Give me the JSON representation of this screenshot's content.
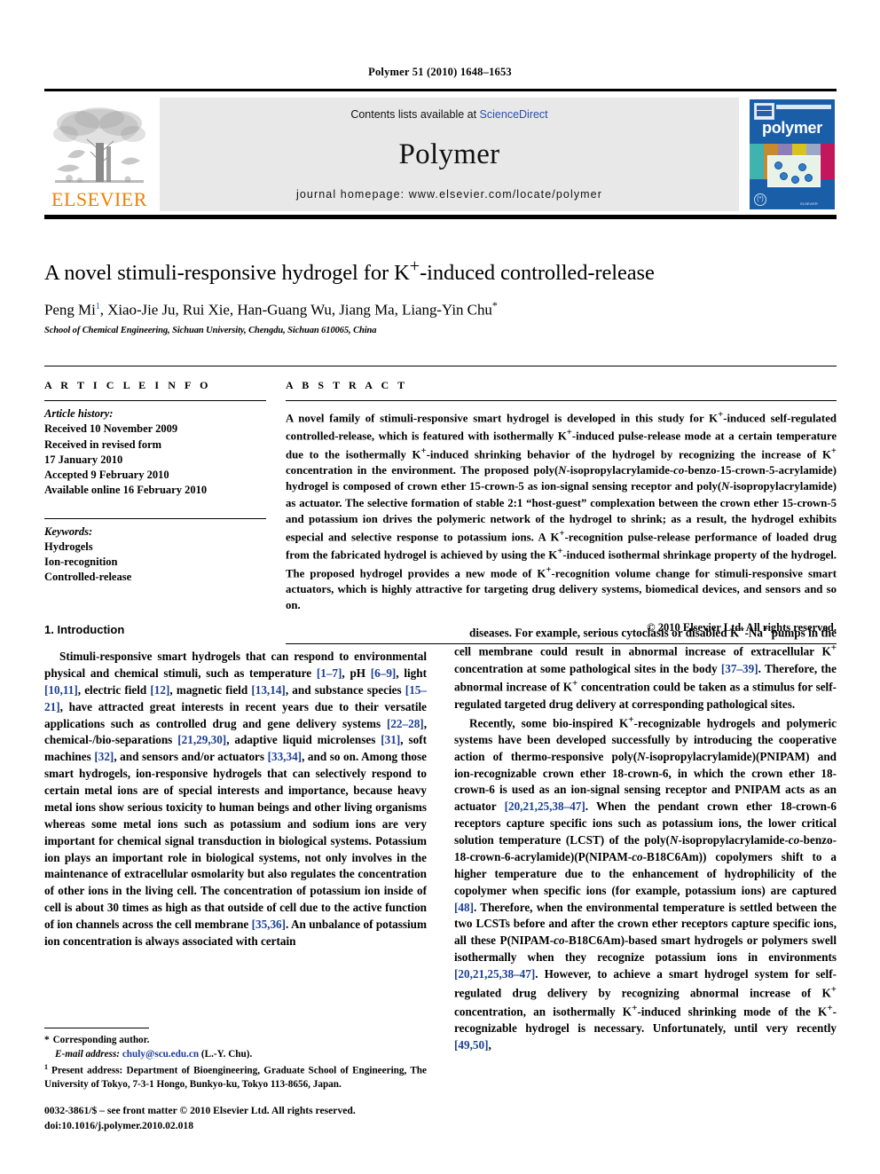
{
  "running_head": "Polymer 51 (2010) 1648–1653",
  "masthead": {
    "publisher_wordmark": "ELSEVIER",
    "contents_prefix": "Contents lists available at ",
    "contents_link": "ScienceDirect",
    "journal_name": "Polymer",
    "homepage": "journal homepage: www.elsevier.com/locate/polymer",
    "cover_title": "polymer"
  },
  "article": {
    "title": "A novel stimuli-responsive hydrogel for K⁺-induced controlled-release",
    "authors": "Peng Mi ¹, Xiao-Jie Ju, Rui Xie, Han-Guang Wu, Jiang Ma, Liang-Yin Chu*",
    "affiliation": "School of Chemical Engineering, Sichuan University, Chengdu, Sichuan 610065, China"
  },
  "article_info": {
    "heading": "A R T I C L E   I N F O",
    "history_label": "Article history:",
    "history": [
      "Received 10 November 2009",
      "Received in revised form",
      "17 January 2010",
      "Accepted 9 February 2010",
      "Available online 16 February 2010"
    ],
    "keywords_label": "Keywords:",
    "keywords": [
      "Hydrogels",
      "Ion-recognition",
      "Controlled-release"
    ]
  },
  "abstract": {
    "heading": "A B S T R A C T",
    "text": "A novel family of stimuli-responsive smart hydrogel is developed in this study for K⁺-induced self-regulated controlled-release, which is featured with isothermally K⁺-induced pulse-release mode at a certain temperature due to the isothermally K⁺-induced shrinking behavior of the hydrogel by recognizing the increase of K⁺ concentration in the environment. The proposed poly(N-isopropylacrylamide-co-benzo-15-crown-5-acrylamide) hydrogel is composed of crown ether 15-crown-5 as ion-signal sensing receptor and poly(N-isopropylacrylamide) as actuator. The selective formation of stable 2:1 “host-guest” complexation between the crown ether 15-crown-5 and potassium ion drives the polymeric network of the hydrogel to shrink; as a result, the hydrogel exhibits especial and selective response to potassium ions. A K⁺-recognition pulse-release performance of loaded drug from the fabricated hydrogel is achieved by using the K⁺-induced isothermal shrinkage property of the hydrogel. The proposed hydrogel provides a new mode of K⁺-recognition volume change for stimuli-responsive smart actuators, which is highly attractive for targeting drug delivery systems, biomedical devices, and sensors and so on.",
    "copyright": "© 2010 Elsevier Ltd. All rights reserved."
  },
  "introduction": {
    "heading": "1.  Introduction",
    "col1_para1": "Stimuli-responsive smart hydrogels that can respond to environmental physical and chemical stimuli, such as temperature [1–7], pH [6–9], light [10,11], electric field [12], magnetic field [13,14], and substance species [15–21], have attracted great interests in recent years due to their versatile applications such as controlled drug and gene delivery systems [22–28], chemical-/bio-separations [21,29,30], adaptive liquid microlenses [31], soft machines [32], and sensors and/or actuators [33,34], and so on. Among those smart hydrogels, ion-responsive hydrogels that can selectively respond to certain metal ions are of special interests and importance, because heavy metal ions show serious toxicity to human beings and other living organisms whereas some metal ions such as potassium and sodium ions are very important for chemical signal transduction in biological systems. Potassium ion plays an important role in biological systems, not only involves in the maintenance of extracellular osmolarity but also regulates the concentration of other ions in the living cell. The concentration of potassium ion inside of cell is about 30 times as high as that outside of cell due to the active function of ion channels across the cell membrane [35,36]. An unbalance of potassium ion concentration is always associated with certain",
    "col2_para1": "diseases. For example, serious cytoclasis or disabled K⁺-Na⁺ pumps in the cell membrane could result in abnormal increase of extracellular K⁺ concentration at some pathological sites in the body [37–39]. Therefore, the abnormal increase of K⁺ concentration could be taken as a stimulus for self-regulated targeted drug delivery at corresponding pathological sites.",
    "col2_para2": "Recently, some bio-inspired K⁺-recognizable hydrogels and polymeric systems have been developed successfully by introducing the cooperative action of thermo-responsive poly(N-isopropylacrylamide)(PNIPAM) and ion-recognizable crown ether 18-crown-6, in which the crown ether 18-crown-6 is used as an ion-signal sensing receptor and PNIPAM acts as an actuator [20,21,25,38–47]. When the pendant crown ether 18-crown-6 receptors capture specific ions such as potassium ions, the lower critical solution temperature (LCST) of the poly(N-isopropylacrylamide-co-benzo-18-crown-6-acrylamide)(P(NIPAM-co-B18C6Am)) copolymers shift to a higher temperature due to the enhancement of hydrophilicity of the copolymer when specific ions (for example, potassium ions) are captured [48]. Therefore, when the environmental temperature is settled between the two LCSTs before and after the crown ether receptors capture specific ions, all these P(NIPAM-co-B18C6Am)-based smart hydrogels or polymers swell isothermally when they recognize potassium ions in environments [20,21,25,38–47]. However, to achieve a smart hydrogel system for self-regulated drug delivery by recognizing abnormal increase of K⁺ concentration, an isothermally K⁺-induced shrinking mode of the K⁺-recognizable hydrogel is necessary. Unfortunately, until very recently [49,50],"
  },
  "footnotes": {
    "corresponding_mark": "*",
    "corresponding": "Corresponding author.",
    "email_label": "E-mail address:",
    "email": "chuly@scu.edu.cn",
    "email_suffix": "(L.-Y. Chu).",
    "present_mark": "1",
    "present_address": "Present address: Department of Bioengineering, Graduate School of Engineering, The University of Tokyo, 7-3-1 Hongo, Bunkyo-ku, Tokyo 113-8656, Japan."
  },
  "imprint": {
    "issn_line": "0032-3861/$ – see front matter © 2010 Elsevier Ltd. All rights reserved.",
    "doi_line": "doi:10.1016/j.polymer.2010.02.018"
  },
  "colors": {
    "link_blue": "#2b50a8",
    "reference_blue": "#1b3f94",
    "elsevier_orange": "#F08000",
    "cover_blue": "#1a5ea8",
    "banner_gray": "#e8e8e8"
  }
}
